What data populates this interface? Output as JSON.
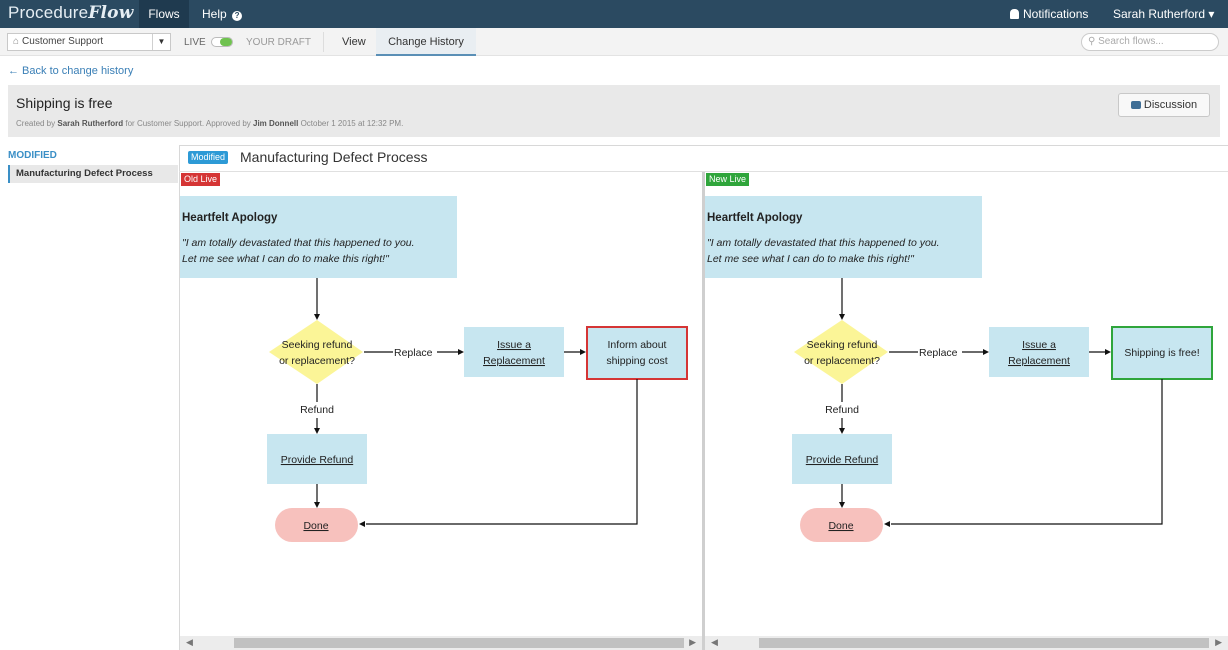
{
  "app": {
    "logo_prefix": "Procedure",
    "logo_suffix": "Flow",
    "nav": {
      "flows": "Flows",
      "help": "Help"
    },
    "notifications": "Notifications",
    "user": "Sarah Rutherford ▾"
  },
  "toolbar": {
    "project": "Customer Support",
    "live_label": "LIVE",
    "draft_label": "YOUR DRAFT",
    "tab_view": "View",
    "tab_history": "Change History",
    "search_placeholder": "Search flows..."
  },
  "page": {
    "back_link": "← Back to change history",
    "title": "Shipping is free",
    "meta_prefix": "Created by ",
    "meta_author": "Sarah Rutherford",
    "meta_mid": " for Customer Support. Approved by ",
    "meta_approver": "Jim Donnell",
    "meta_date": " October 1 2015 at 12:32 PM.",
    "discussion_button": "Discussion"
  },
  "sidebar": {
    "heading": "MODIFIED",
    "items": [
      {
        "label": "Manufacturing Defect Process"
      }
    ]
  },
  "comparison": {
    "badge": "Modified",
    "title": "Manufacturing Defect Process",
    "old_label": "Old Live",
    "new_label": "New Live",
    "colors": {
      "old": "#d53535",
      "new": "#2fa53b",
      "step_fill": "#c7e6f0",
      "decision_fill": "#fbf597",
      "end_fill": "#f7c1bd"
    },
    "flow": {
      "apology_title": "Heartfelt Apology",
      "apology_line1": "\"I am totally devastated that this happened to you.",
      "apology_line2": "Let me see what I can do to make this right!\"",
      "decision_line1": "Seeking refund",
      "decision_line2": "or replacement?",
      "replace_label": "Replace",
      "refund_label": "Refund",
      "issue_line1": "Issue a",
      "issue_line2": "Replacement",
      "provide_refund": "Provide Refund",
      "done": "Done"
    },
    "old_changed_line1": "Inform about",
    "old_changed_line2": "shipping cost",
    "new_changed": "Shipping is free!"
  }
}
